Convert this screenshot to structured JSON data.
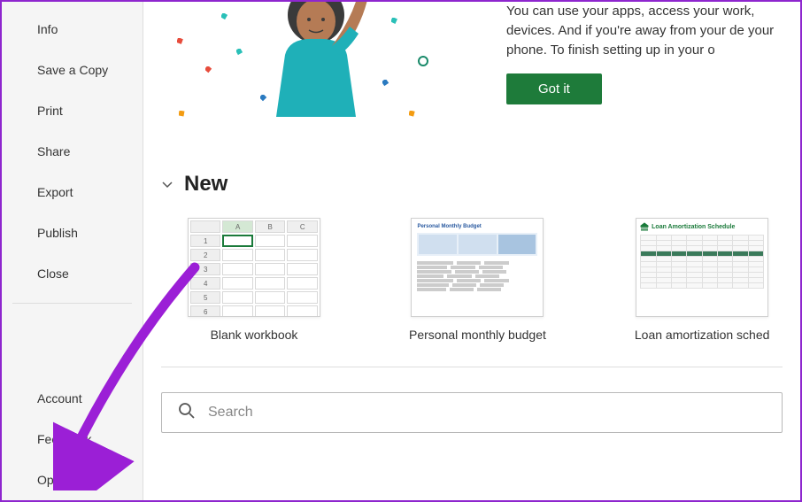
{
  "sidebar": {
    "top": [
      {
        "label": "Info"
      },
      {
        "label": "Save a Copy"
      },
      {
        "label": "Print"
      },
      {
        "label": "Share"
      },
      {
        "label": "Export"
      },
      {
        "label": "Publish"
      },
      {
        "label": "Close"
      }
    ],
    "bottom": [
      {
        "label": "Account"
      },
      {
        "label": "Feedback"
      },
      {
        "label": "Options"
      }
    ]
  },
  "banner": {
    "text": "You can use your apps, access your work, devices. And if you're away from your de your phone. To finish setting up in your o",
    "button": "Got it"
  },
  "new_section": {
    "title": "New",
    "templates": [
      {
        "label": "Blank workbook"
      },
      {
        "label": "Personal monthly budget"
      },
      {
        "label": "Loan amortization sched"
      }
    ]
  },
  "search": {
    "placeholder": "Search"
  },
  "thumb_budget_title": "Personal Monthly Budget",
  "thumb_loan_title": "Loan Amortization Schedule"
}
